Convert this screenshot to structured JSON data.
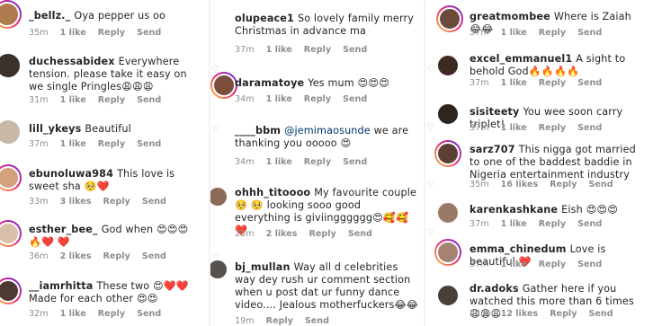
{
  "icons": {
    "like": "heart-outline-icon"
  },
  "left": [
    {
      "user": "_bellz._",
      "text": "Oya pepper us oo",
      "time": "35m",
      "likes": "1 like",
      "reply": "Reply",
      "send": "Send",
      "avatar": "#b07a4f",
      "ring": true
    },
    {
      "user": "duchessabidex",
      "text": "Everywhere tension. please take it easy on we single Pringles😩😩😩",
      "time": "31m",
      "likes": "1 like",
      "reply": "Reply",
      "send": "Send",
      "avatar": "#3b3129",
      "ring": false
    },
    {
      "user": "lill_ykeys",
      "text": "Beautiful",
      "time": "37m",
      "likes": "1 like",
      "reply": "Reply",
      "send": "Send",
      "avatar": "#c9b8a6",
      "ring": false
    },
    {
      "user": "ebunoluwa984",
      "text": "This love is sweet sha 🥺❤️",
      "time": "33m",
      "likes": "3 likes",
      "reply": "Reply",
      "send": "Send",
      "avatar": "#d1a27b",
      "ring": true
    },
    {
      "user": "esther_bee_",
      "text": "God when 😍😍😍🔥❤️ ❤️",
      "time": "36m",
      "likes": "2 likes",
      "reply": "Reply",
      "send": "Send",
      "avatar": "#d8c0a8",
      "ring": true
    },
    {
      "user": "__iamrhitta",
      "text": "These two 😍❤️❤️ Made for each other 😍😍",
      "time": "32m",
      "likes": "1 like",
      "reply": "Reply",
      "send": "Send",
      "avatar": "#4c3a33",
      "ring": true
    }
  ],
  "middle": [
    {
      "user": "olupeace1",
      "text": "So lovely family merry Christmas in advance ma",
      "time": "37m",
      "likes": "1 like",
      "reply": "Reply",
      "send": "Send",
      "avatar": "#b98c6a",
      "ring": false
    },
    {
      "user": "daramatoye",
      "text": "Yes mum 😍😍😍",
      "time": "34m",
      "likes": "1 like",
      "reply": "Reply",
      "send": "Send",
      "avatar": "#7a4e3a",
      "ring": true
    },
    {
      "user": "____bbm",
      "mention": "@jemimaosunde",
      "text": "we are thanking you ooooo 😍",
      "time": "34m",
      "likes": "1 like",
      "reply": "Reply",
      "send": "Send",
      "avatar": "#262626",
      "ring": false
    },
    {
      "user": "ohhh_titoooo",
      "text": "My favourite couple🥺 🥺 looking sooo good everything is giviingggggg😍🥰🥰❤️",
      "time": "25m",
      "likes": "2 likes",
      "reply": "Reply",
      "send": "Send",
      "avatar": "#8c6a55",
      "ring": false
    },
    {
      "user": "bj_mullan",
      "text": "Way all d celebrities way dey rush ur comment section when u post dat ur funny dance video.... Jealous motherfuckers😂😂",
      "time": "19m",
      "likes": "",
      "reply": "Reply",
      "send": "Send",
      "avatar": "#55504a",
      "ring": false
    }
  ],
  "right": [
    {
      "user": "greatmombee",
      "text": "Where is Zaiah 😂😂",
      "time": "37m",
      "likes": "1 like",
      "reply": "Reply",
      "send": "Send",
      "avatar": "#6b4a3c",
      "ring": true
    },
    {
      "user": "excel_emmanuel1",
      "text": "A sight to behold God🔥🔥🔥🔥",
      "time": "37m",
      "likes": "1 like",
      "reply": "Reply",
      "send": "Send",
      "avatar": "#3d2b22",
      "ring": false
    },
    {
      "user": "sisiteety",
      "text": "You wee soon carry triplet!",
      "time": "37m",
      "likes": "1 like",
      "reply": "Reply",
      "send": "Send",
      "avatar": "#2f2520",
      "ring": false
    },
    {
      "user": "sarz707",
      "text": "This nigga got married to one of the baddest baddie in Nigeria entertainment industry",
      "time": "35m",
      "likes": "16 likes",
      "reply": "Reply",
      "send": "Send",
      "avatar": "#5b4033",
      "ring": true
    },
    {
      "user": "karenkashkane",
      "text": "Eish 😍😍😍",
      "time": "37m",
      "likes": "1 like",
      "reply": "Reply",
      "send": "Send",
      "avatar": "#9a7a66",
      "ring": false
    },
    {
      "user": "emma_chinedum",
      "text": "Love is beautiful ❤️",
      "time": "37m",
      "likes": "1 like",
      "reply": "Reply",
      "send": "Send",
      "avatar": "#a58370",
      "ring": true
    },
    {
      "user": "dr.adoks",
      "text": "Gather here if you watched this more than 6 times 😩😩😩",
      "time": "24m",
      "likes": "12 likes",
      "reply": "Reply",
      "send": "Send",
      "avatar": "#4a4038",
      "ring": false
    }
  ]
}
